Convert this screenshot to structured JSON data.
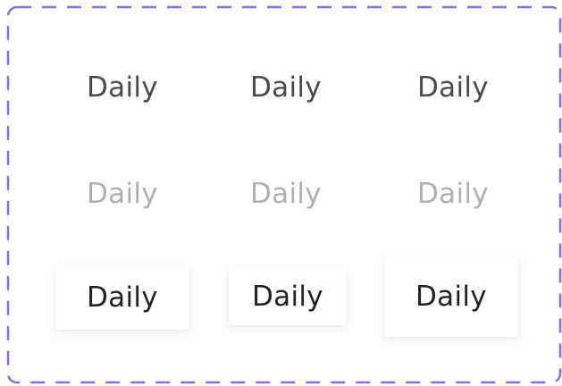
{
  "frame": {
    "border_color": "#8a6cf0"
  },
  "rows": [
    {
      "state": "default",
      "items": [
        {
          "label": "Daily"
        },
        {
          "label": "Daily"
        },
        {
          "label": "Daily"
        }
      ]
    },
    {
      "state": "disabled",
      "items": [
        {
          "label": "Daily"
        },
        {
          "label": "Daily"
        },
        {
          "label": "Daily"
        }
      ]
    },
    {
      "state": "elevated",
      "items": [
        {
          "label": "Daily"
        },
        {
          "label": "Daily"
        },
        {
          "label": "Daily"
        }
      ]
    }
  ],
  "colors": {
    "text_default": "#4b4b4b",
    "text_disabled": "#b0b0b0",
    "text_elevated": "#222222"
  }
}
